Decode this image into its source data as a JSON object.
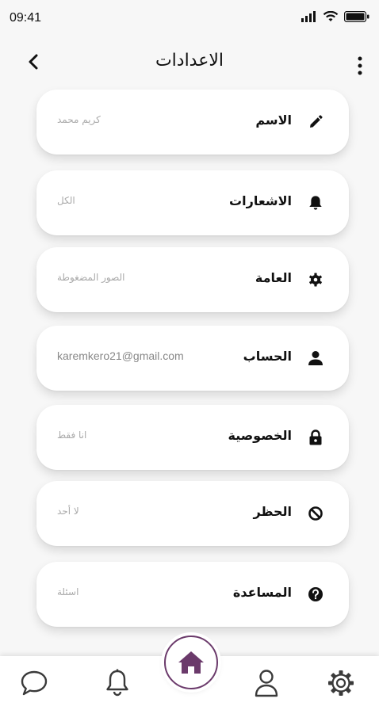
{
  "status_bar": {
    "time": "09:41"
  },
  "header": {
    "title": "الاعدادات"
  },
  "settings": [
    {
      "label": "الاسم",
      "value": "كريم محمد",
      "icon": "pencil-icon"
    },
    {
      "label": "الاشعارات",
      "value": "الكل",
      "icon": "bell-icon"
    },
    {
      "label": "العامة",
      "value": "الصور المضغوطة",
      "icon": "gear-icon"
    },
    {
      "label": "الحساب",
      "value": "karemkero21@gmail.com",
      "icon": "person-icon"
    },
    {
      "label": "الخصوصية",
      "value": "انا فقط",
      "icon": "lock-icon"
    },
    {
      "label": "الحظر",
      "value": "لا أحد",
      "icon": "block-icon"
    },
    {
      "label": "المساعدة",
      "value": "اسئلة",
      "icon": "help-icon"
    }
  ],
  "bottom_nav": {
    "items": [
      "chat-icon",
      "bell-icon",
      "home-icon",
      "profile-icon",
      "settings-icon"
    ],
    "accent": "#6b3a6b"
  }
}
